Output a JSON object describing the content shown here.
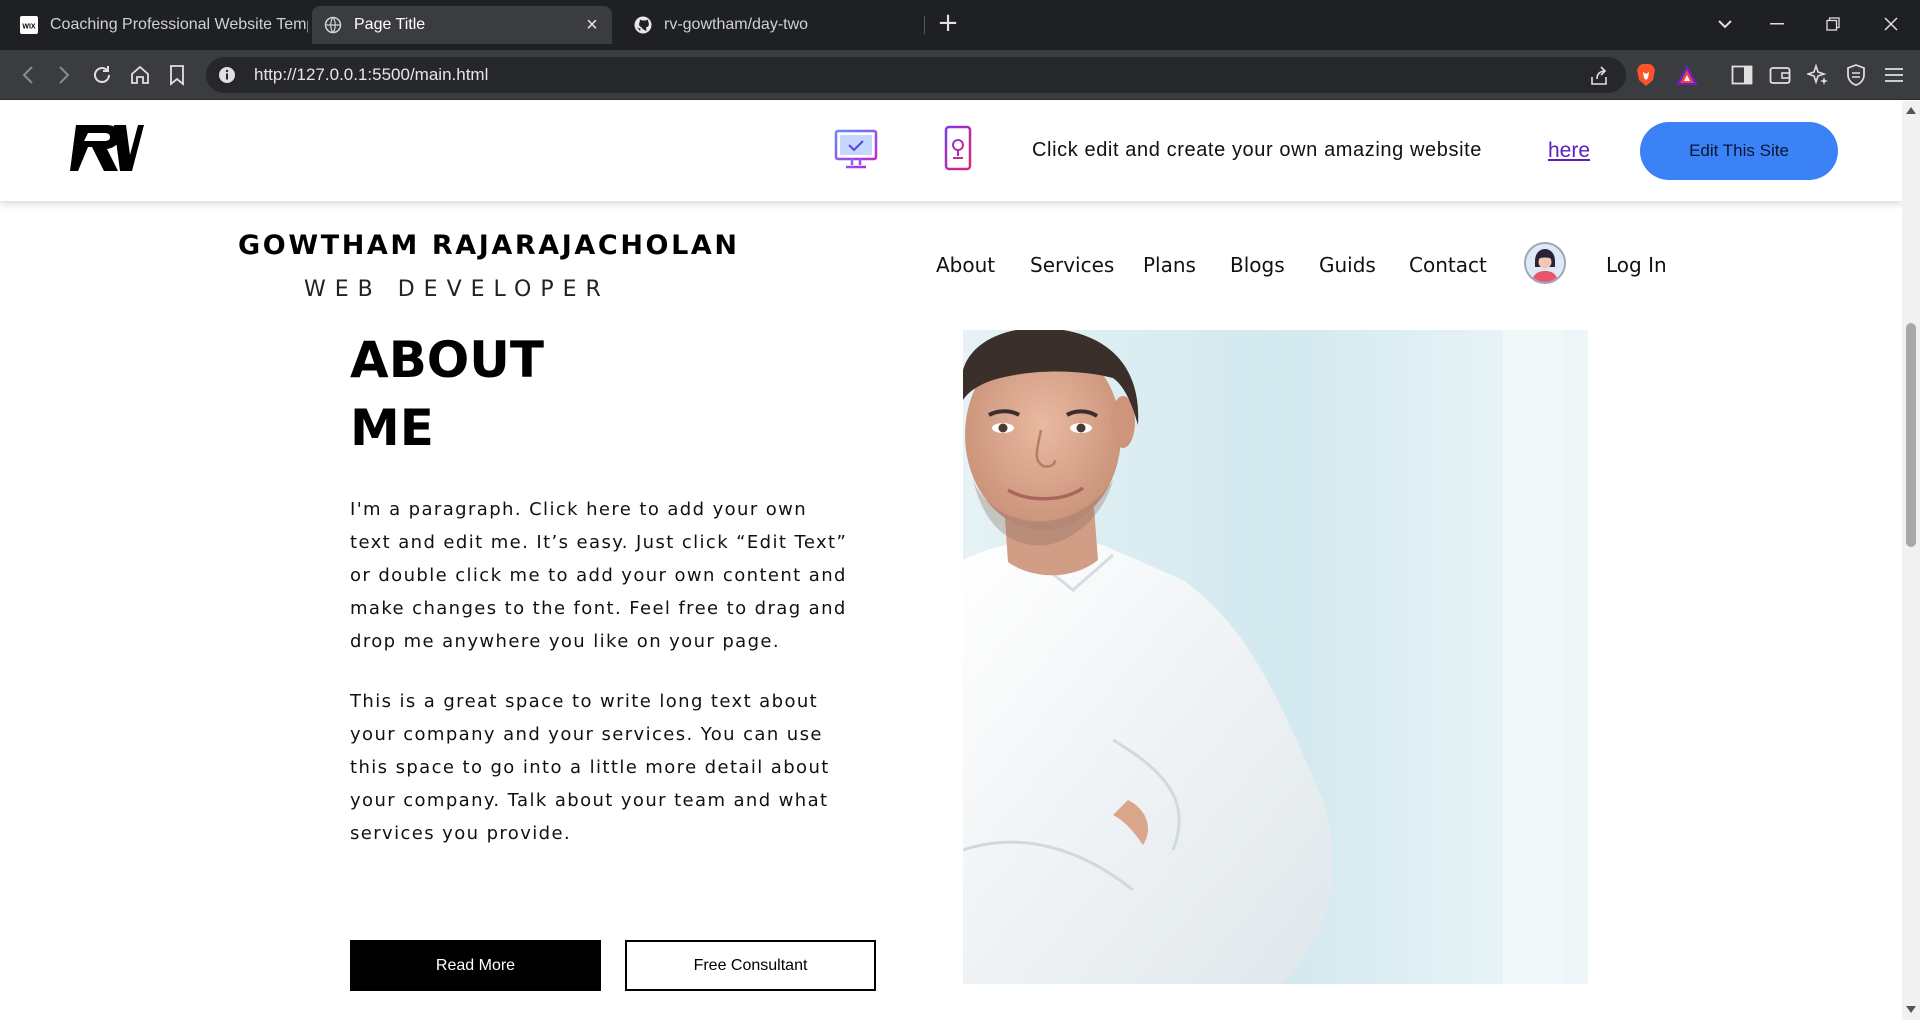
{
  "browser": {
    "tabs": [
      {
        "title": "Coaching Professional Website Temp",
        "favicon": "wix-icon"
      },
      {
        "title": "Page Title",
        "favicon": "globe-icon"
      },
      {
        "title": "rv-gowtham/day-two",
        "favicon": "github-icon"
      }
    ],
    "url": "http://127.0.0.1:5500/main.html"
  },
  "wix_bar": {
    "promo_text": "Click edit and create your own amazing website",
    "link_text": "here",
    "edit_button": "Edit This Site",
    "accent_color": "#3b82f6"
  },
  "site": {
    "name": "GOWTHAM RAJARAJACHOLAN",
    "subtitle": "WEB DEVELOPER",
    "nav": [
      "About",
      "Services",
      "Plans",
      "Blogs",
      "Guids",
      "Contact"
    ],
    "login": "Log In"
  },
  "about": {
    "title_line1": "ABOUT",
    "title_line2": "ME",
    "paragraph1_lines": [
      "I'm a paragraph. Click here to add your own",
      "text and edit me. It’s easy. Just click “Edit Text”",
      "or double click me to add your own content and",
      "make changes to the font. Feel free to drag and",
      "drop me anywhere you like on your page."
    ],
    "paragraph2_lines": [
      "This is a great space to write long text about",
      "your company and your services. You can use",
      "this space to go into a little more detail about",
      "your company. Talk about your team and what",
      "services you provide."
    ],
    "read_more": "Read More",
    "free_consultant": "Free Consultant"
  }
}
